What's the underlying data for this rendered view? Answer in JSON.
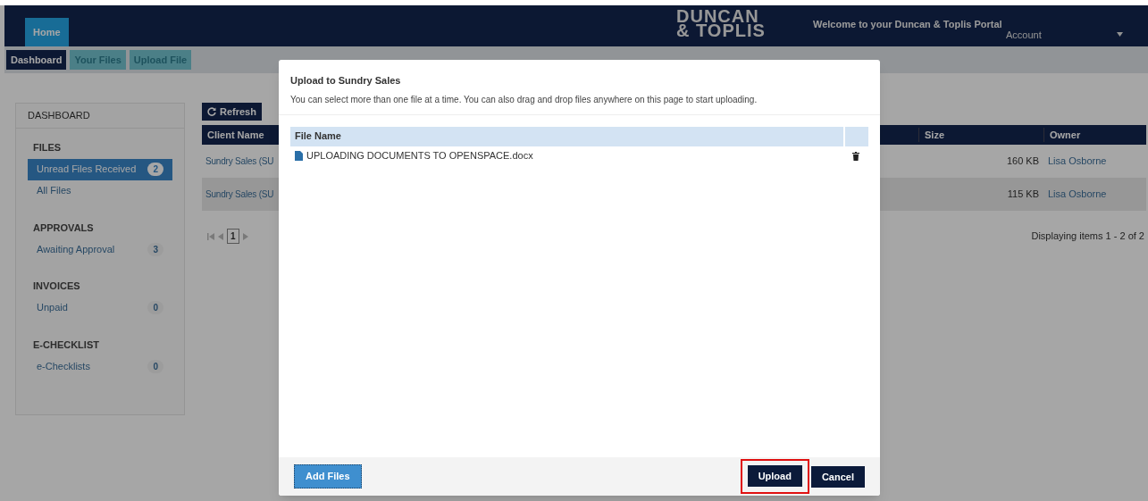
{
  "navbar": {
    "tabs": [
      {
        "label": "Home",
        "selected": true
      }
    ],
    "logo": [
      "DUNCAN",
      "& TOPLIS"
    ],
    "welcome": "Welcome to your Duncan & Toplis Portal",
    "account": "Account"
  },
  "subnav": [
    {
      "label": "Dashboard",
      "selected": true
    },
    {
      "label": "Your Files",
      "selected": false
    },
    {
      "label": "Upload File",
      "selected": false
    }
  ],
  "sidebar": {
    "title": "DASHBOARD",
    "sections": [
      {
        "heading": "FILES",
        "items": [
          {
            "label": "Unread Files Received",
            "count": "2",
            "selected": true
          },
          {
            "label": "All Files",
            "selected": false
          }
        ]
      },
      {
        "heading": "APPROVALS",
        "items": [
          {
            "label": "Awaiting Approval",
            "count": "3",
            "selected": false
          }
        ]
      },
      {
        "heading": "INVOICES",
        "items": [
          {
            "label": "Unpaid",
            "count": "0",
            "selected": false
          }
        ]
      },
      {
        "heading": "E-CHECKLIST",
        "items": [
          {
            "label": "e-Checklists",
            "count": "0",
            "selected": false
          }
        ]
      }
    ]
  },
  "refresh": "Refresh",
  "table": {
    "columns": [
      "Client Name",
      "Size",
      "Owner"
    ],
    "rows": [
      {
        "client": "Sundry Sales (SU",
        "size": "160 KB",
        "owner": "Lisa Osborne",
        "selected": false
      },
      {
        "client": "Sundry Sales (SU",
        "size": "115 KB",
        "owner": "Lisa Osborne",
        "selected": true
      }
    ]
  },
  "pager": {
    "page": "1",
    "summary": "Displaying items 1 - 2 of 2"
  },
  "dialog": {
    "title": "Upload to Sundry Sales",
    "description": "You can select more than one file at a time. You can also drag and drop files anywhere on this page to start uploading.",
    "column": "File Name",
    "files": [
      {
        "name": "UPLOADING DOCUMENTS TO OPENSPACE.docx"
      }
    ],
    "buttons": [
      {
        "label": "Add Files",
        "kind": "add",
        "highlighted": false
      },
      {
        "label": "Upload",
        "kind": "primary",
        "highlighted": true
      },
      {
        "label": "Cancel",
        "kind": "primary",
        "highlighted": false
      }
    ]
  }
}
